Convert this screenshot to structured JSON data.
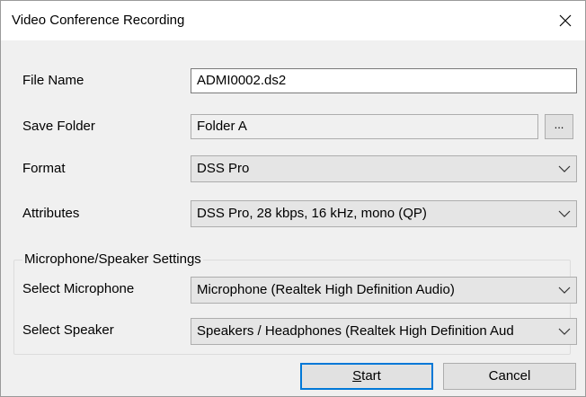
{
  "window": {
    "title": "Video Conference Recording"
  },
  "form": {
    "file_name": {
      "label": "File Name",
      "value": "ADMI0002.ds2"
    },
    "save_folder": {
      "label": "Save Folder",
      "value": "Folder A",
      "browse_label": "..."
    },
    "format": {
      "label": "Format",
      "value": "DSS Pro"
    },
    "attributes": {
      "label": "Attributes",
      "value": "DSS Pro, 28 kbps, 16 kHz, mono (QP)"
    }
  },
  "mic_speaker": {
    "group_title": "Microphone/Speaker Settings",
    "microphone": {
      "label": "Select Microphone",
      "value": "Microphone (Realtek High Definition Audio)"
    },
    "speaker": {
      "label": "Select Speaker",
      "value": "Speakers / Headphones (Realtek High Definition Aud"
    }
  },
  "buttons": {
    "start_label": "Start",
    "start_mnemonic": "S",
    "start_rest": "tart",
    "cancel_label": "Cancel"
  },
  "icons": {
    "close": "close-icon",
    "dropdown": "chevron-down-icon"
  },
  "colors": {
    "focus_accent": "#0078d7",
    "client_bg": "#f0f0f0"
  }
}
